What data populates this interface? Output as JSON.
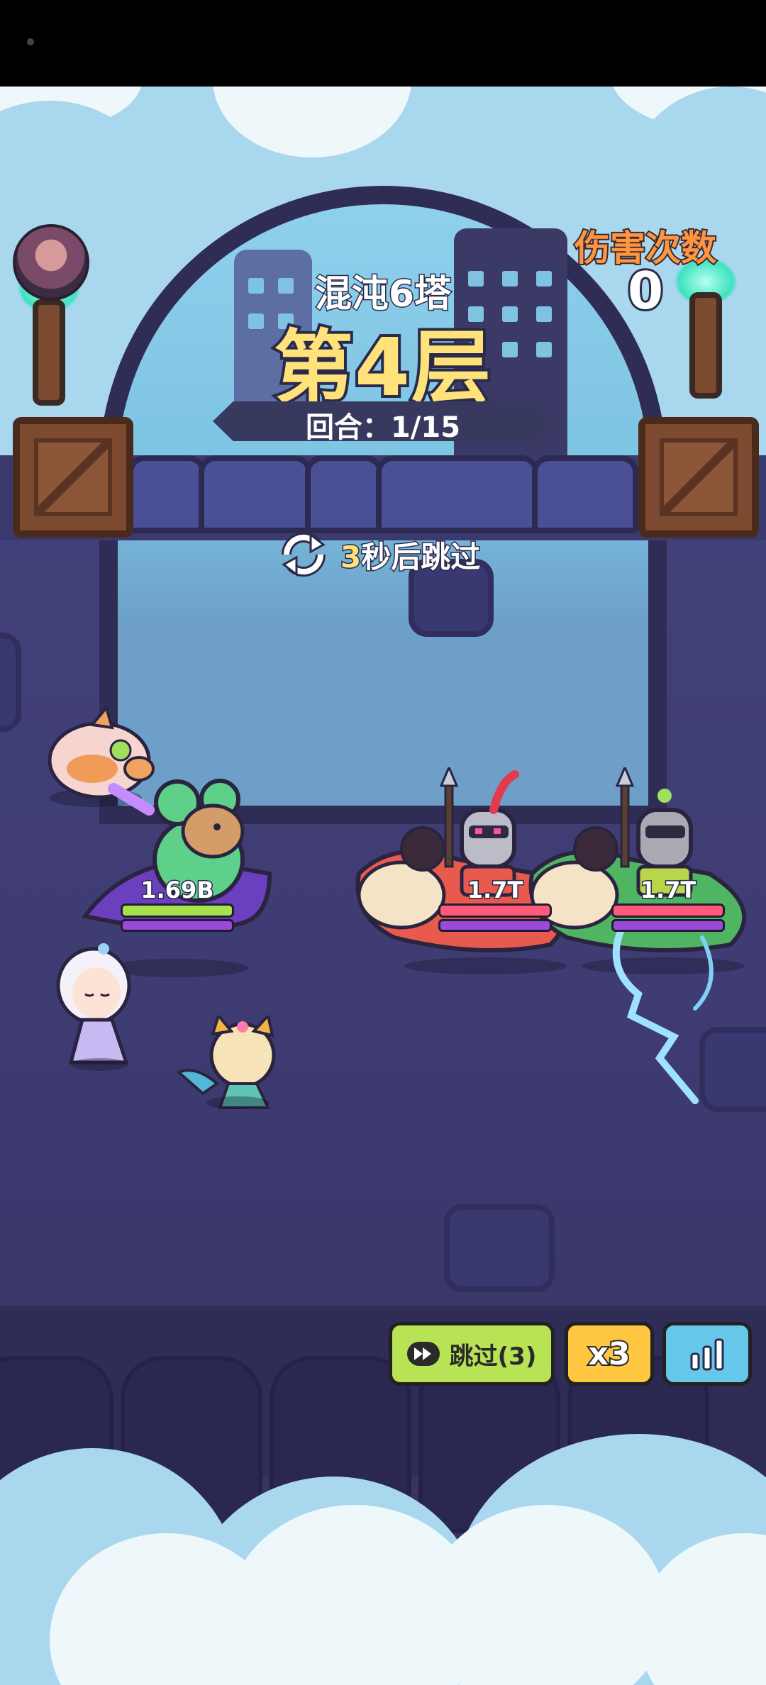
{
  "tower": {
    "name": "混沌6塔",
    "floor": "第4层",
    "round": "回合：1/15"
  },
  "damage": {
    "label": "伤害次数",
    "count": "0"
  },
  "auto_skip": {
    "seconds": "3",
    "suffix": "秒后跳过"
  },
  "allies": [
    {
      "name": "capybara-frog-hero",
      "hp": "1.69B"
    },
    {
      "name": "pig-pet",
      "hp": ""
    },
    {
      "name": "snow-princess",
      "hp": ""
    },
    {
      "name": "fox-girl",
      "hp": ""
    }
  ],
  "enemies": [
    {
      "name": "red-dino-knight",
      "hp": "1.7T"
    },
    {
      "name": "green-dino-knight",
      "hp": "1.7T"
    }
  ],
  "controls": {
    "skip_label": "跳过(3)",
    "speed_label": "x3"
  },
  "colors": {
    "hp_ally": "#a6e04a",
    "hp_enemy": "#ff5a7a",
    "mana": "#9b4ad8",
    "title": "#ffe27a",
    "damage_label": "#ff9540"
  }
}
